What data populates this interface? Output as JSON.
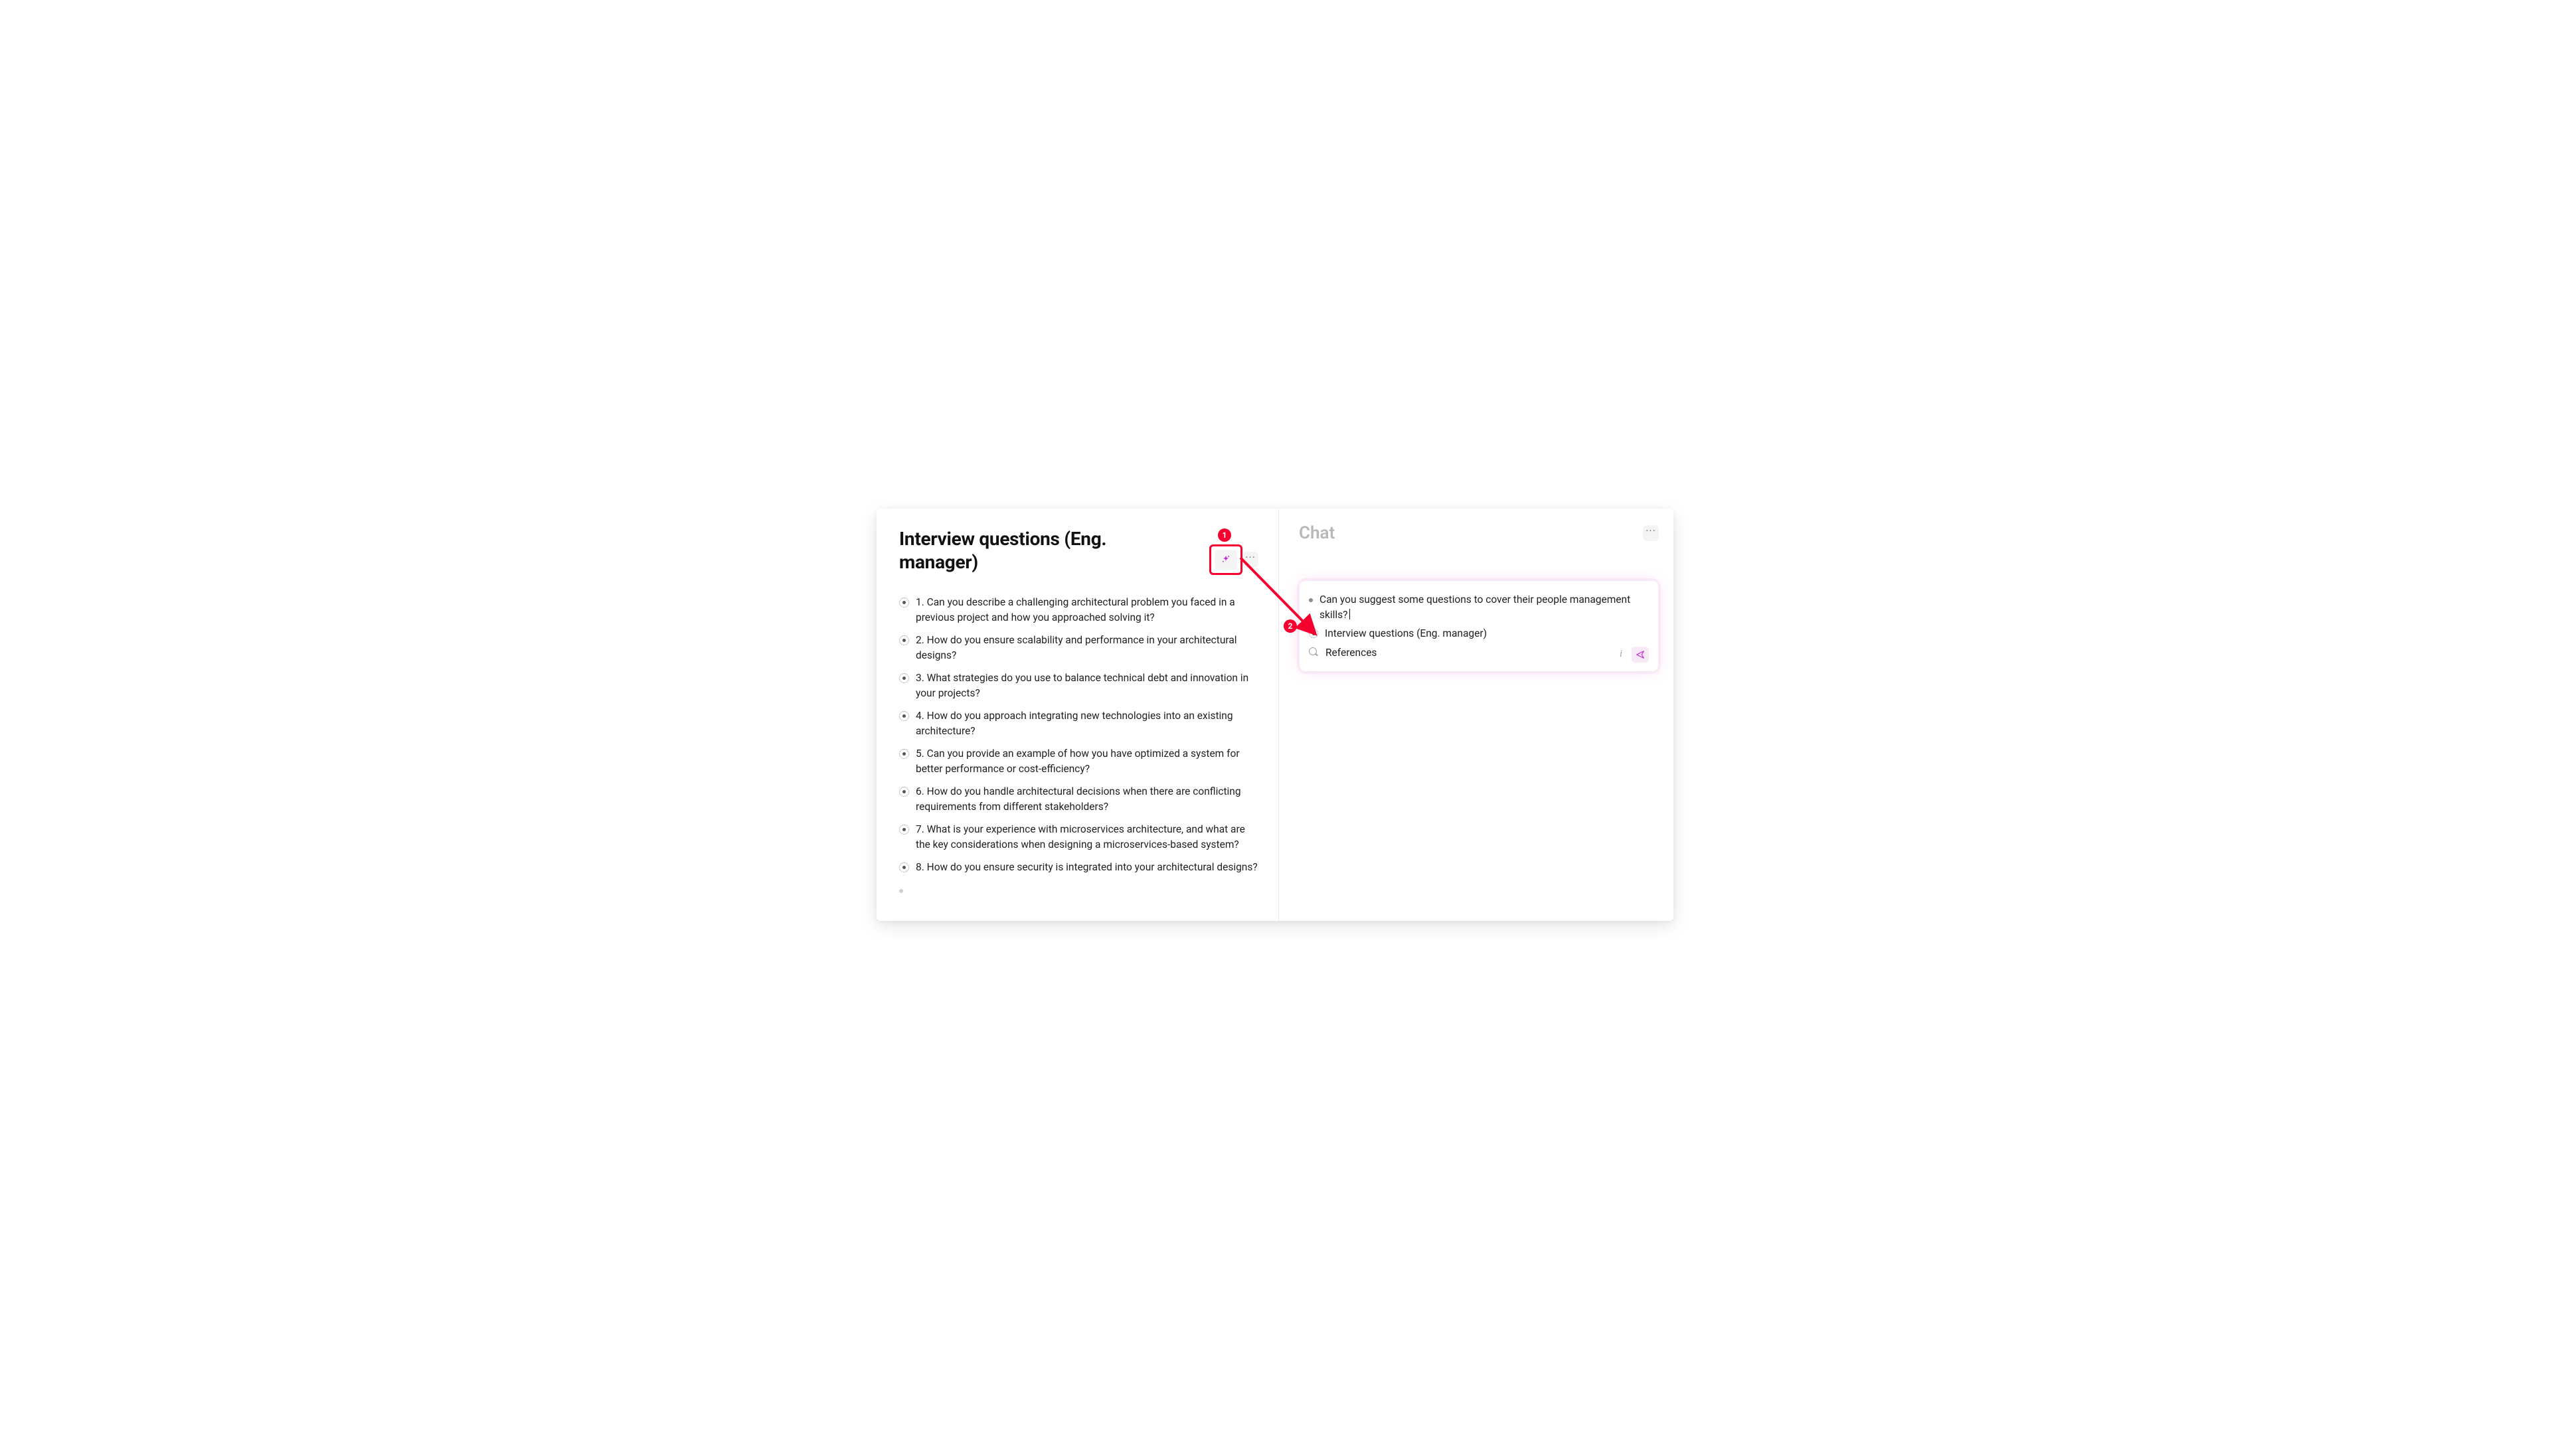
{
  "doc": {
    "title": "Interview questions (Eng. manager)",
    "questions": [
      "1. Can you describe a challenging architectural problem you faced in a previous project and how you approached solving it?",
      "2. How do you ensure scalability and performance in your architectural designs?",
      "3. What strategies do you use to balance technical debt and innovation in your projects?",
      "4. How do you approach integrating new technologies into an existing architecture?",
      "5. Can you provide an example of how you have optimized a system for better performance or cost-efficiency?",
      "6. How do you handle architectural decisions when there are conflicting requirements from different stakeholders?",
      "7. What is your experience with microservices architecture, and what are the key considerations when designing a microservices-based system?",
      "8. How do you ensure security is integrated into your architectural designs?"
    ]
  },
  "chat": {
    "title": "Chat",
    "prompt": "Can you suggest some questions to cover their people management skills?",
    "context_doc": "Interview questions (Eng. manager)",
    "references_label": "References",
    "info_label": "i"
  },
  "annotations": {
    "callout1": "1",
    "callout2": "2"
  }
}
